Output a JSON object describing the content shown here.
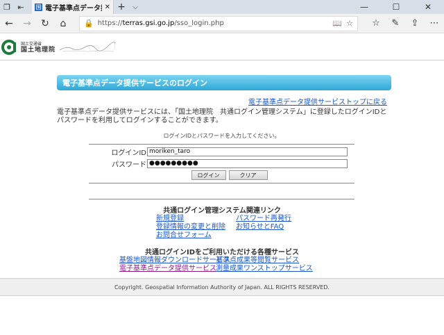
{
  "browser": {
    "tab_title": "電子基準点データ提供サ",
    "tab_favicon": "国",
    "url_prefix": "https://",
    "url_domain": "terras.gsi.go.jp",
    "url_path": "/sso_login.php"
  },
  "header": {
    "logo_small": "国土交通省",
    "logo_big": "国土地理院"
  },
  "page": {
    "title": "電子基準点データ提供サービスのログイン",
    "top_link": "電子基準点データ提供サービストップに戻る",
    "intro": "電子基準点データ提供サービスには、「国土地理院　共通ログイン管理システム」に登録したログインIDとパスワードを利用してログインすることができます。",
    "instruction": "ログインIDとパスワードを入力してください。"
  },
  "form": {
    "login_label": "ログインID",
    "login_value": "moriken_taro",
    "password_label": "パスワード",
    "password_value": "●●●●●●●●●",
    "login_button": "ログイン",
    "clear_button": "クリア"
  },
  "related": {
    "title": "共通ログイン管理システム関連リンク",
    "links": [
      "新規登録",
      "パスワード再発行",
      "登録情報の変更と削除",
      "お知らせとFAQ",
      "お問合せフォーム"
    ]
  },
  "services": {
    "title": "共通ログインIDをご利用いただける各種サービス",
    "links": [
      "基盤地図情報ダウンロードサービス",
      "基準点成果等閲覧サービス",
      "電子基準点データ提供サービス",
      "測量成果ワンストップサービス"
    ]
  },
  "footer": {
    "copyright": "Copyright. Geospatial Information Authority of Japan. ALL RIGHTS RESERVED."
  },
  "colors": {
    "title_bar": "#2fa8d8",
    "link": "#1a57c9",
    "visited": "#8b1a8b"
  }
}
